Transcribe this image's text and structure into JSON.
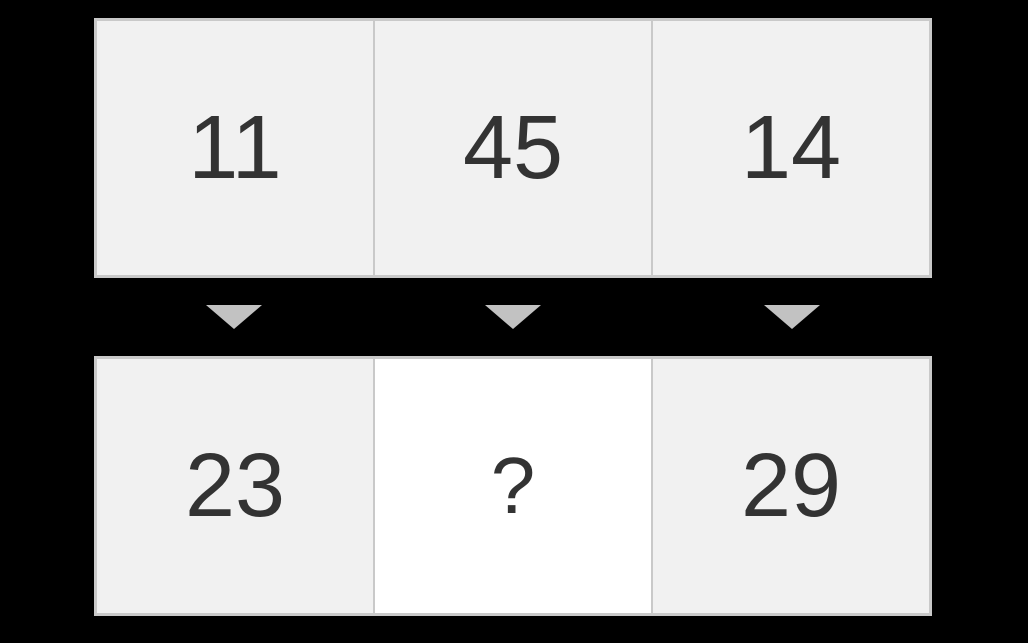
{
  "puzzle": {
    "top_row": [
      "11",
      "45",
      "14"
    ],
    "bottom_row": [
      "23",
      "?",
      "29"
    ],
    "unknown_index": 1
  }
}
